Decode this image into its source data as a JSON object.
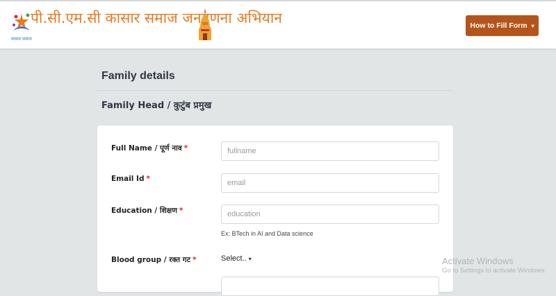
{
  "header": {
    "logo_text": "पी.सी.एम.सी कासार समाज जनगणना अभियान",
    "logo_subtext": "कासार समाज",
    "how_to_fill_label": "How to Fill Form",
    "brand_color": "#b5541a"
  },
  "page": {
    "section_title": "Family details",
    "subsection_title": "Family Head / कुटुंब प्रमुख"
  },
  "form": {
    "full_name": {
      "label": "Full Name / पूर्ण नाव",
      "required_mark": "*",
      "placeholder": "fullname",
      "value": ""
    },
    "email": {
      "label": "Email Id",
      "required_mark": "*",
      "placeholder": "email",
      "value": ""
    },
    "education": {
      "label": "Education / शिक्षण",
      "required_mark": "*",
      "placeholder": "education",
      "value": "",
      "hint": "Ex: BTech in AI and Data science"
    },
    "blood_group": {
      "label": "Blood group / रक्त गट",
      "required_mark": "*",
      "selected": "Select.."
    }
  },
  "watermark": {
    "line1": "Activate Windows",
    "line2": "Go to Settings to activate Windows."
  }
}
